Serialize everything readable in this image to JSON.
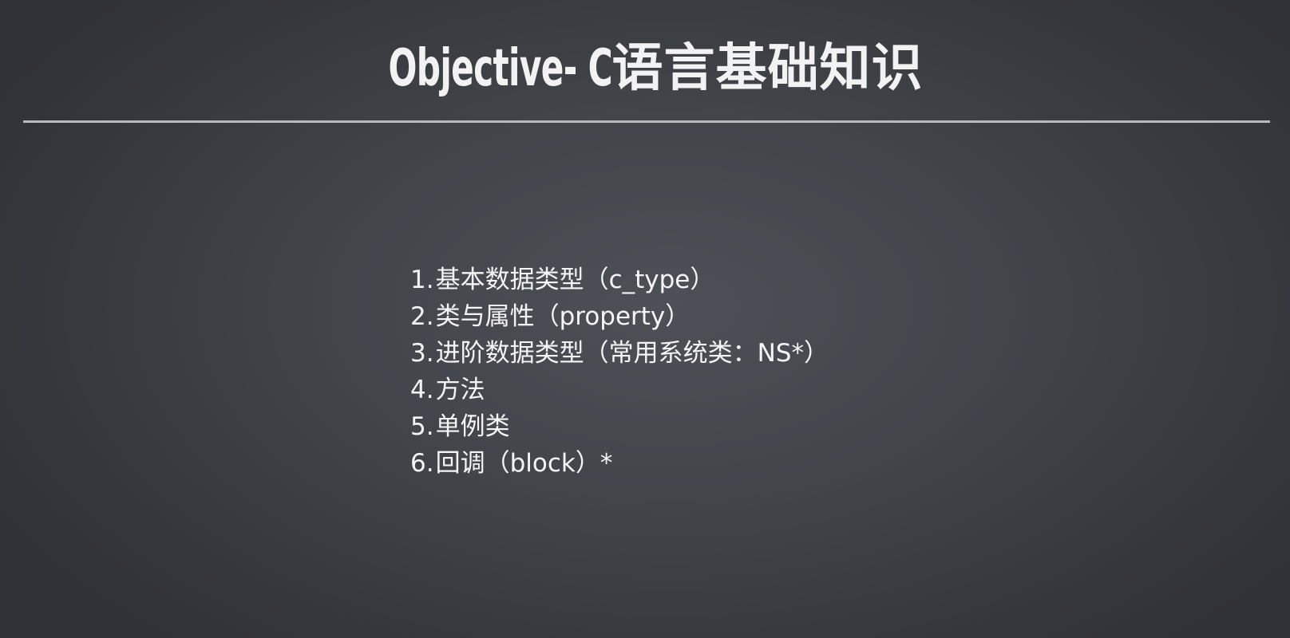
{
  "slide": {
    "title_latin": "Objective- C",
    "title_cjk": "语言基础知识",
    "items": [
      {
        "number": "1.",
        "text": "基本数据类型（c_type）"
      },
      {
        "number": "2.",
        "text": "类与属性（property）"
      },
      {
        "number": "3.",
        "text": "进阶数据类型（常用系统类：NS*）"
      },
      {
        "number": "4.",
        "text": "方法"
      },
      {
        "number": "5.",
        "text": "单例类"
      },
      {
        "number": "6.",
        "text": "回调（block）*"
      }
    ]
  },
  "colors": {
    "background_center": "#4d5157",
    "background_edge": "#2f3236",
    "text": "#f5f5f5",
    "divider": "#b7b9bc"
  }
}
